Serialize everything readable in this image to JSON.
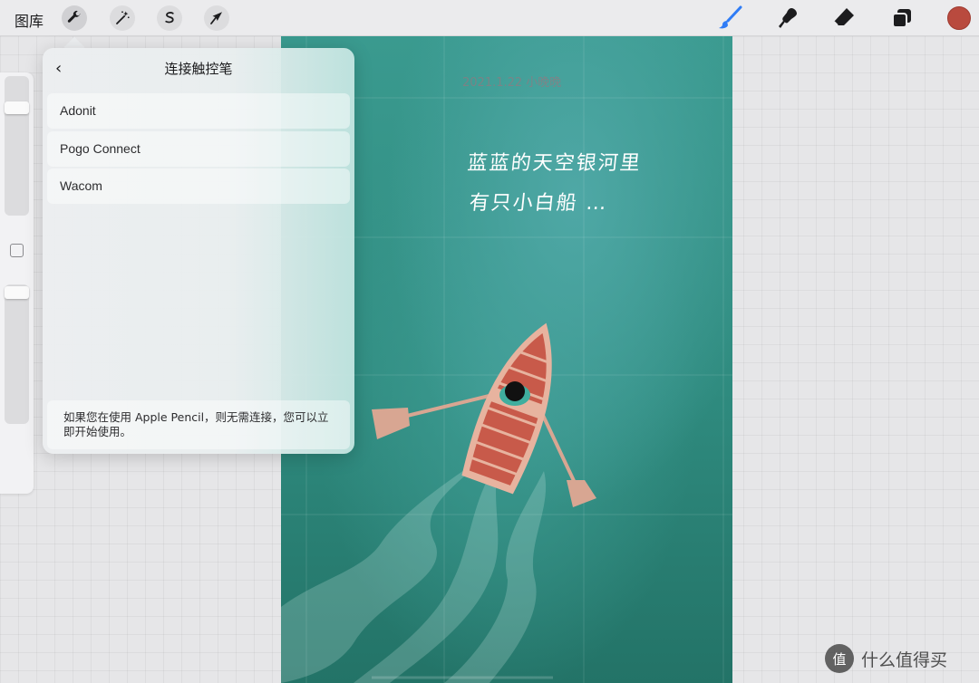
{
  "toolbar": {
    "gallery_label": "图库",
    "tools": [
      {
        "name": "actions",
        "icon": "wrench-icon",
        "active": true
      },
      {
        "name": "adjustments",
        "icon": "magic-wand-icon",
        "active": false
      },
      {
        "name": "selection",
        "icon": "selection-s-icon",
        "active": false
      },
      {
        "name": "transform",
        "icon": "arrow-cursor-icon",
        "active": false
      }
    ],
    "right_tools": [
      {
        "name": "brush",
        "icon": "brush-icon",
        "color": "#2f7cf6"
      },
      {
        "name": "smudge",
        "icon": "smudge-icon",
        "color": "#1c1c1e"
      },
      {
        "name": "eraser",
        "icon": "eraser-icon",
        "color": "#1c1c1e"
      },
      {
        "name": "layers",
        "icon": "layers-icon",
        "color": "#1c1c1e"
      }
    ],
    "current_color": "#b94a3e"
  },
  "panel": {
    "back_icon": "‹",
    "title": "连接触控笔",
    "devices": [
      "Adonit",
      "Pogo Connect",
      "Wacom"
    ],
    "note": "如果您在使用 Apple Pencil，则无需连接，您可以立即开始使用。"
  },
  "canvas": {
    "date_text": "2021.1.22 小晚晚",
    "line1": "蓝蓝的天空银河里",
    "line2": "有只小白船 …",
    "water_color": "#2f8b7f",
    "boat_color": "#c85a4a"
  },
  "watermark": {
    "logo_text": "值",
    "text": "什么值得买"
  }
}
